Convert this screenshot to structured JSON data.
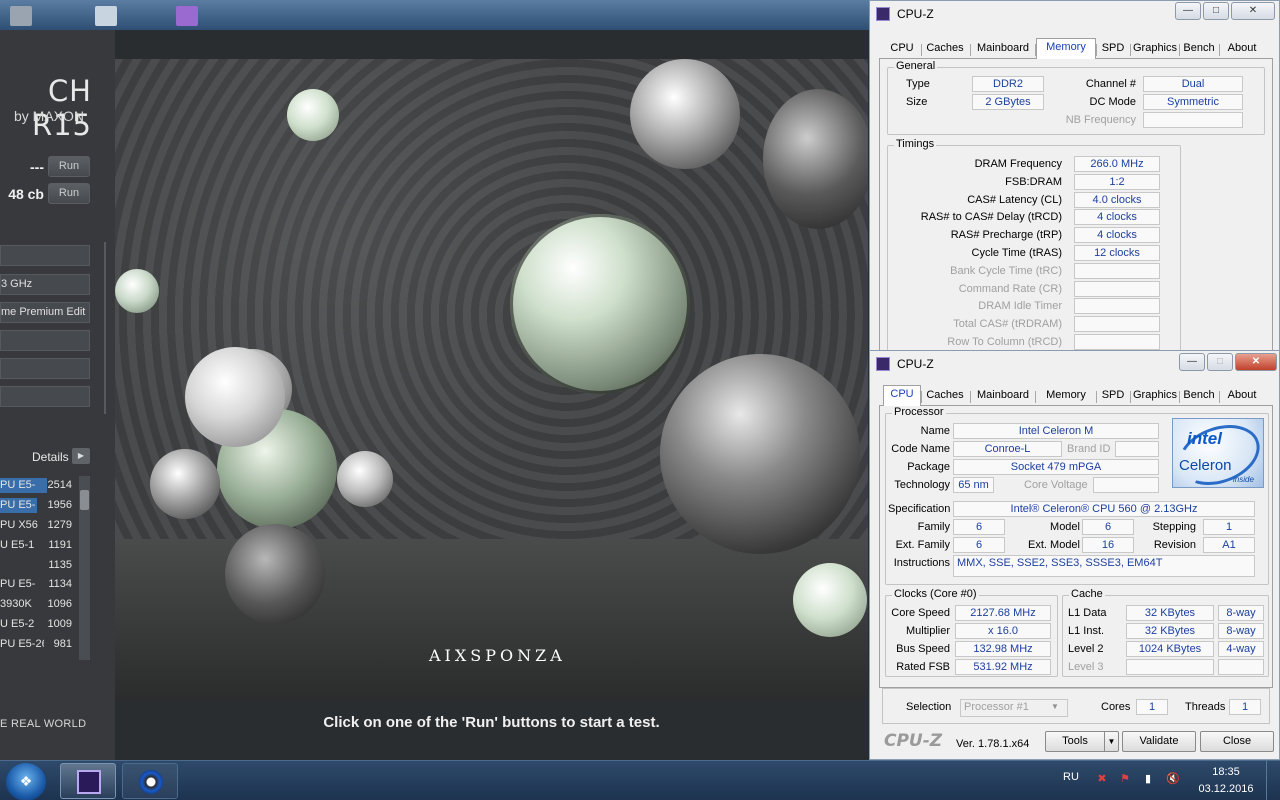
{
  "cinebench": {
    "logo_title": "CH R15",
    "logo_sub": "by MAXON",
    "runs": [
      {
        "score": "---",
        "button": "Run"
      },
      {
        "score": "48 cb",
        "button": "Run"
      }
    ],
    "system_fields": [
      "",
      "3 GHz",
      "me Premium Edit",
      "",
      "",
      ""
    ],
    "details_label": "Details",
    "ranking": [
      {
        "name": "PU E5-",
        "score": "2514",
        "bar": 1.0
      },
      {
        "name": "PU E5-",
        "score": "1956",
        "bar": 0.78
      },
      {
        "name": "PU X56",
        "score": "1279",
        "bar": 0
      },
      {
        "name": "U E5-1",
        "score": "1191",
        "bar": 0
      },
      {
        "name": "",
        "score": "1135",
        "bar": 0
      },
      {
        "name": "PU E5-",
        "score": "1134",
        "bar": 0
      },
      {
        "name": "3930K",
        "score": "1096",
        "bar": 0
      },
      {
        "name": "U E5-2",
        "score": "1009",
        "bar": 0
      },
      {
        "name": "PU E5-26",
        "score": "981",
        "bar": 0
      }
    ],
    "footer_text": "E REAL WORLD",
    "render_logo": "AIXSPONZA",
    "status": "Click on one of the 'Run' buttons to start a test."
  },
  "cpuz_memory": {
    "title": "CPU-Z",
    "tabs": [
      "CPU",
      "Caches",
      "Mainboard",
      "Memory",
      "SPD",
      "Graphics",
      "Bench",
      "About"
    ],
    "active_tab": "Memory",
    "general_title": "General",
    "type_label": "Type",
    "type": "DDR2",
    "size_label": "Size",
    "size": "2 GBytes",
    "channel_label": "Channel #",
    "channel": "Dual",
    "dcmode_label": "DC Mode",
    "dcmode": "Symmetric",
    "nbfreq_label": "NB Frequency",
    "nbfreq": "",
    "timings_title": "Timings",
    "timings": [
      {
        "label": "DRAM Frequency",
        "value": "266.0 MHz",
        "enabled": true
      },
      {
        "label": "FSB:DRAM",
        "value": "1:2",
        "enabled": true
      },
      {
        "label": "CAS# Latency (CL)",
        "value": "4.0 clocks",
        "enabled": true
      },
      {
        "label": "RAS# to CAS# Delay (tRCD)",
        "value": "4 clocks",
        "enabled": true
      },
      {
        "label": "RAS# Precharge (tRP)",
        "value": "4 clocks",
        "enabled": true
      },
      {
        "label": "Cycle Time (tRAS)",
        "value": "12 clocks",
        "enabled": true
      },
      {
        "label": "Bank Cycle Time (tRC)",
        "value": "",
        "enabled": false
      },
      {
        "label": "Command Rate (CR)",
        "value": "",
        "enabled": false
      },
      {
        "label": "DRAM Idle Timer",
        "value": "",
        "enabled": false
      },
      {
        "label": "Total CAS# (tRDRAM)",
        "value": "",
        "enabled": false
      },
      {
        "label": "Row To Column (tRCD)",
        "value": "",
        "enabled": false
      }
    ]
  },
  "cpuz_cpu": {
    "title": "CPU-Z",
    "tabs": [
      "CPU",
      "Caches",
      "Mainboard",
      "Memory",
      "SPD",
      "Graphics",
      "Bench",
      "About"
    ],
    "active_tab": "CPU",
    "processor_title": "Processor",
    "name_label": "Name",
    "name": "Intel Celeron M",
    "codename_label": "Code Name",
    "codename": "Conroe-L",
    "brandid_label": "Brand ID",
    "brandid": "",
    "package_label": "Package",
    "package": "Socket 479 mPGA",
    "technology_label": "Technology",
    "technology": "65 nm",
    "corevoltage_label": "Core Voltage",
    "corevoltage": "",
    "spec_label": "Specification",
    "spec": "Intel® Celeron® CPU          560  @ 2.13GHz",
    "family_label": "Family",
    "family": "6",
    "model_label": "Model",
    "model": "6",
    "stepping_label": "Stepping",
    "stepping": "1",
    "extfamily_label": "Ext. Family",
    "extfamily": "6",
    "extmodel_label": "Ext. Model",
    "extmodel": "16",
    "revision_label": "Revision",
    "revision": "A1",
    "instructions_label": "Instructions",
    "instructions": "MMX, SSE, SSE2, SSE3, SSSE3, EM64T",
    "intel_word": "intel",
    "intel_brand": "Celeron",
    "intel_inside": "inside",
    "clocks_title": "Clocks (Core #0)",
    "corespeed_label": "Core Speed",
    "corespeed": "2127.68 MHz",
    "multiplier_label": "Multiplier",
    "multiplier": "x 16.0",
    "busspeed_label": "Bus Speed",
    "busspeed": "132.98 MHz",
    "ratedfsb_label": "Rated FSB",
    "ratedfsb": "531.92 MHz",
    "cache_title": "Cache",
    "l1data_label": "L1 Data",
    "l1data": "32 KBytes",
    "l1data_way": "8-way",
    "l1inst_label": "L1 Inst.",
    "l1inst": "32 KBytes",
    "l1inst_way": "8-way",
    "l2_label": "Level 2",
    "l2": "1024 KBytes",
    "l2_way": "4-way",
    "l3_label": "Level 3",
    "l3": "",
    "l3_way": "",
    "selection_label": "Selection",
    "selection": "Processor #1",
    "cores_label": "Cores",
    "cores": "1",
    "threads_label": "Threads",
    "threads": "1",
    "bottom_logo": "CPU-Z",
    "version": "Ver. 1.78.1.x64",
    "tools_label": "Tools",
    "validate_label": "Validate",
    "close_label": "Close"
  },
  "taskbar": {
    "language": "RU",
    "time": "18:35",
    "date": "03.12.2016"
  }
}
